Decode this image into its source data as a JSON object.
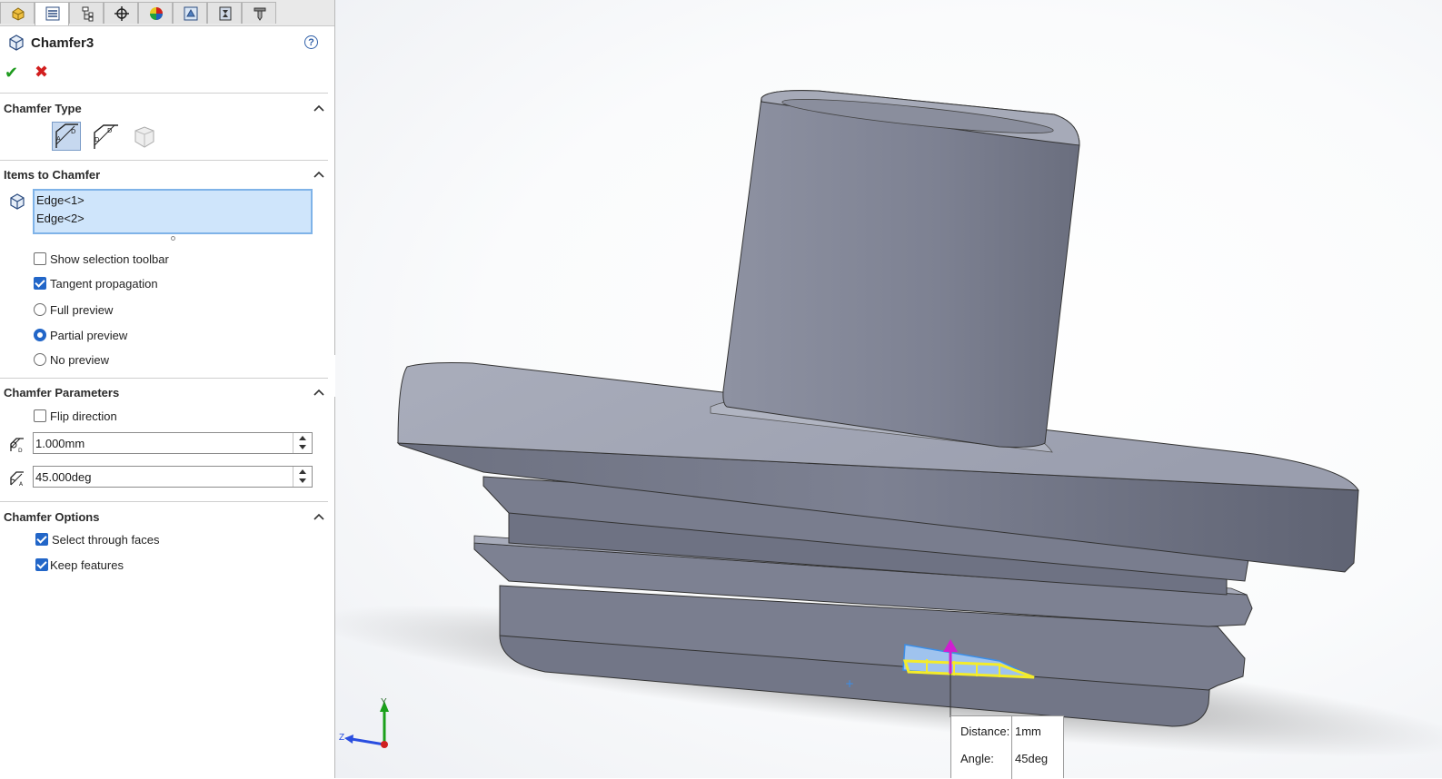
{
  "feature": {
    "title": "Chamfer3"
  },
  "tabs": [
    {
      "name": "feature-manager"
    },
    {
      "name": "property-manager"
    },
    {
      "name": "configuration-manager"
    },
    {
      "name": "dimxpert-manager"
    },
    {
      "name": "display-manager"
    },
    {
      "name": "cam-feature-manager"
    },
    {
      "name": "cam-operation-manager"
    },
    {
      "name": "cam-tool-manager"
    }
  ],
  "sections": {
    "chamfer_type": {
      "header": "Chamfer Type"
    },
    "items": {
      "header": "Items to Chamfer",
      "edges": [
        "Edge<1>",
        "Edge<2>"
      ],
      "show_selection_toolbar": "Show selection toolbar",
      "tangent_propagation": "Tangent propagation",
      "full_preview": "Full preview",
      "partial_preview": "Partial preview",
      "no_preview": "No preview"
    },
    "parameters": {
      "header": "Chamfer Parameters",
      "flip_direction": "Flip direction",
      "distance": "1.000mm",
      "angle": "45.000deg"
    },
    "options": {
      "header": "Chamfer Options",
      "select_through_faces": "Select through faces",
      "keep_features": "Keep features"
    }
  },
  "callout": {
    "distance_label": "Distance:",
    "distance_value": "1mm",
    "angle_label": "Angle:",
    "angle_value": "45deg"
  },
  "triad": {
    "y": "Y",
    "z": "Z"
  },
  "colors": {
    "accent": "#2266c8",
    "ok": "#1e9b1e",
    "cancel": "#d21e1e",
    "model": "#787c8c"
  }
}
